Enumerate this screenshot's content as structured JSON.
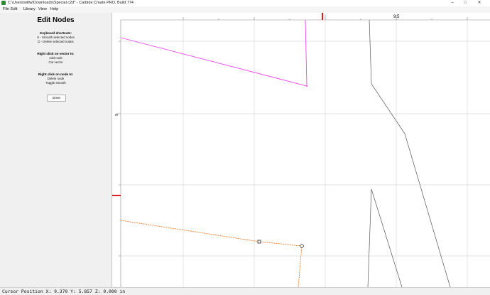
{
  "window": {
    "title": "C:\\Users\\willw\\Downloads\\Special.c2d* - Carbide Create PRO, Build 774",
    "minimize_glyph": "–",
    "maximize_glyph": "□",
    "close_glyph": "✕"
  },
  "menu": {
    "file": "File",
    "edit": "Edit",
    "library": "Library",
    "view": "View",
    "help": "Help"
  },
  "panel": {
    "heading": "Edit Nodes",
    "shortcuts_title": "Keyboard shortcuts:",
    "shortcuts": [
      "S - Smooth selected nodes",
      "D - Delete selected nodes"
    ],
    "vector_title": "Right click on vector to:",
    "vector_actions": [
      "Add node",
      "Cut vector"
    ],
    "node_title": "Right click on node to:",
    "node_actions": [
      "Delete node",
      "Toggle smooth"
    ],
    "done_label": "Done"
  },
  "canvas": {
    "ruler_x_label": "9.5",
    "ruler_y_label": "6",
    "colors": {
      "magenta_path": "#ee44ee",
      "orange_path": "#f07820",
      "gray_path": "#555555",
      "grid": "#d8d8d8",
      "ruler_marker": "#e02020"
    }
  },
  "status": {
    "text": "Cursor Position X: 9.370 Y: 5.857 Z: 0.000 in"
  }
}
